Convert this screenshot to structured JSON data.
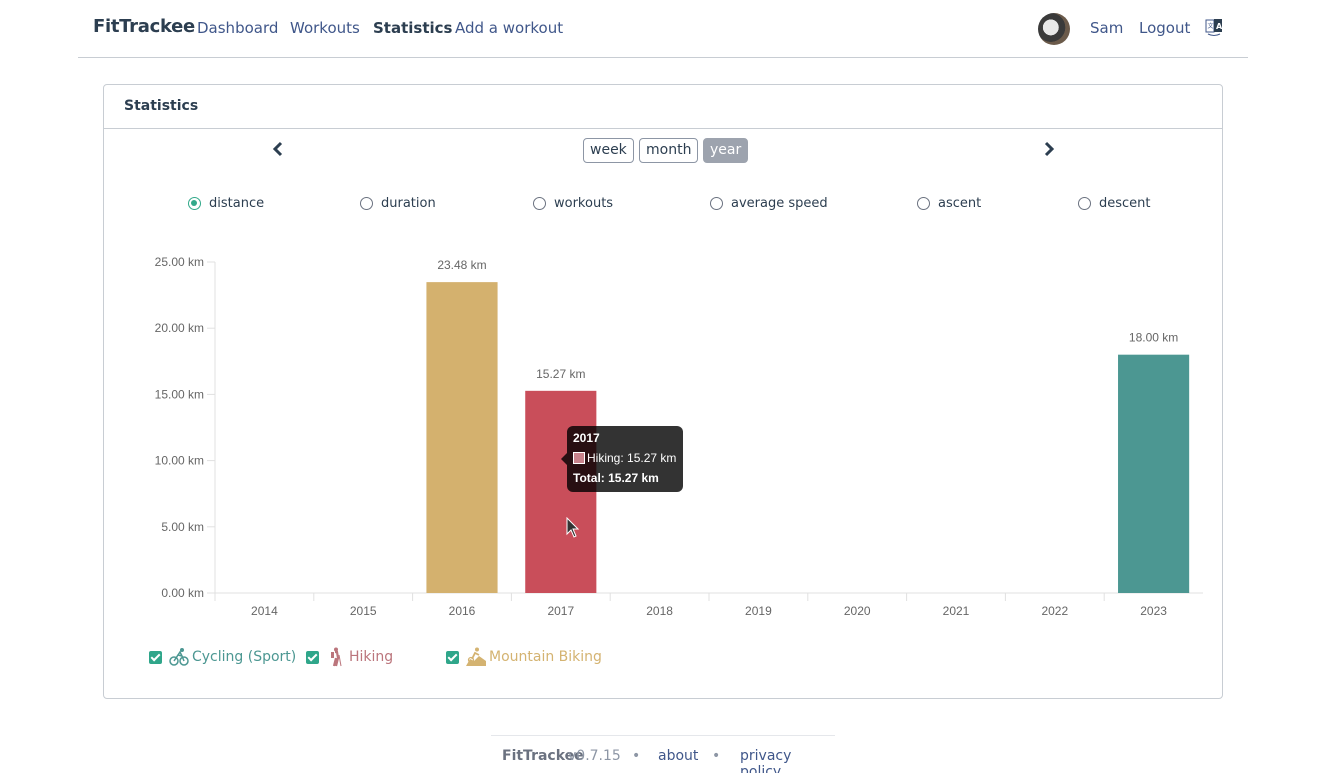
{
  "navbar": {
    "brand": "FitTrackee",
    "links": [
      "Dashboard",
      "Workouts",
      "Statistics",
      "Add a workout"
    ],
    "active": "Statistics",
    "user": "Sam",
    "logout": "Logout",
    "language_icon": "translate-icon"
  },
  "card": {
    "title": "Statistics",
    "prev_icon": "chevron-left-icon",
    "next_icon": "chevron-right-icon",
    "periods": [
      "week",
      "month",
      "year"
    ],
    "selected_period": "year",
    "metrics": [
      "distance",
      "duration",
      "workouts",
      "average speed",
      "ascent",
      "descent"
    ],
    "selected_metric": "distance"
  },
  "tooltip": {
    "title": "2017",
    "row": "Hiking: 15.27 km",
    "total": "Total: 15.27 km",
    "swatch_color": "#c8838c"
  },
  "legend": [
    {
      "label": "Cycling (Sport)",
      "color": "#4c9792",
      "checked": true,
      "icon": "cycling-icon"
    },
    {
      "label": "Hiking",
      "color": "#bb757c",
      "checked": true,
      "icon": "hiking-icon"
    },
    {
      "label": "Mountain Biking",
      "color": "#d4b371",
      "checked": true,
      "icon": "mountain-biking-icon"
    }
  ],
  "footer": {
    "brand": "FitTrackee",
    "version": "v0.7.15",
    "separator": "•",
    "about": "about",
    "privacy": "privacy policy"
  },
  "chart_data": {
    "type": "bar",
    "stacked": true,
    "title": "",
    "xlabel": "",
    "ylabel": "",
    "unit": "km",
    "categories": [
      "2014",
      "2015",
      "2016",
      "2017",
      "2018",
      "2019",
      "2020",
      "2021",
      "2022",
      "2023"
    ],
    "ylim": [
      0,
      25
    ],
    "yticks": [
      0,
      5,
      10,
      15,
      20,
      25
    ],
    "ytick_labels": [
      "0.00 km",
      "5.00 km",
      "10.00 km",
      "15.00 km",
      "20.00 km",
      "25.00 km"
    ],
    "grid": false,
    "series": [
      {
        "name": "Cycling (Sport)",
        "color": "#4c9792",
        "values": [
          0,
          0,
          0,
          0,
          0,
          0,
          0,
          0,
          0,
          18.0
        ]
      },
      {
        "name": "Hiking",
        "color": "#c94e5a",
        "values": [
          0,
          0,
          0,
          15.27,
          0,
          0,
          0,
          0,
          0,
          0
        ]
      },
      {
        "name": "Mountain Biking",
        "color": "#d4b16e",
        "values": [
          0,
          0,
          23.48,
          0,
          0,
          0,
          0,
          0,
          0,
          0
        ]
      }
    ],
    "totals_labels": [
      "",
      "",
      "23.48 km",
      "15.27 km",
      "",
      "",
      "",
      "",
      "",
      "18.00 km"
    ],
    "legend": "bottom-left"
  }
}
